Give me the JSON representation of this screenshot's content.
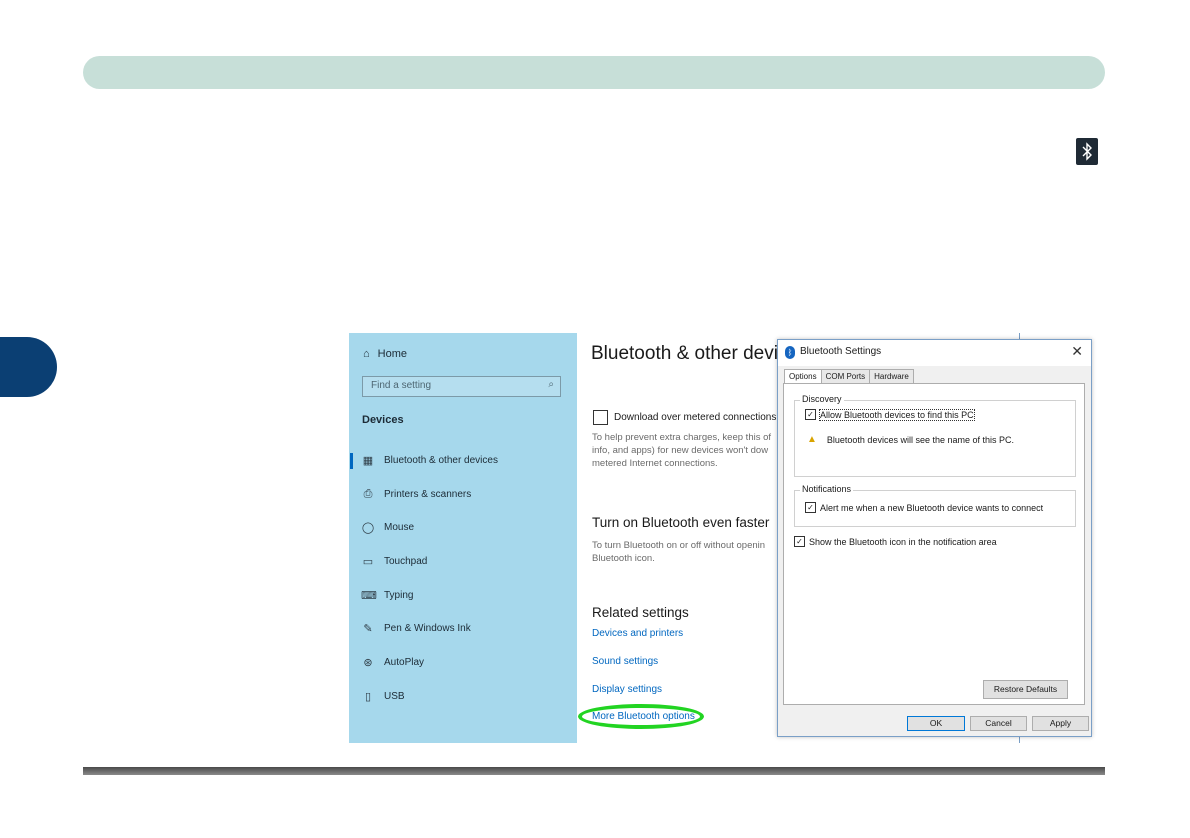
{
  "settings": {
    "sidebar": {
      "home": "Home",
      "search_placeholder": "Find a setting",
      "section_title": "Devices",
      "items": [
        {
          "label": "Bluetooth & other devices",
          "icon": "devices-icon"
        },
        {
          "label": "Printers & scanners",
          "icon": "printer-icon"
        },
        {
          "label": "Mouse",
          "icon": "mouse-icon"
        },
        {
          "label": "Touchpad",
          "icon": "touchpad-icon"
        },
        {
          "label": "Typing",
          "icon": "keyboard-icon"
        },
        {
          "label": "Pen & Windows Ink",
          "icon": "pen-icon"
        },
        {
          "label": "AutoPlay",
          "icon": "autoplay-icon"
        },
        {
          "label": "USB",
          "icon": "usb-icon"
        }
      ]
    },
    "main": {
      "title": "Bluetooth & other devi",
      "metered_label": "Download over metered connections",
      "metered_desc_1": "To help prevent extra charges, keep this of",
      "metered_desc_2": "info, and apps) for new devices won't dow",
      "metered_desc_3": "metered Internet connections.",
      "quick_title": "Turn on Bluetooth even faster",
      "quick_desc_1": "To turn Bluetooth on or off without openin",
      "quick_desc_2": "Bluetooth icon.",
      "related_title": "Related settings",
      "links": [
        "Devices and printers",
        "Sound settings",
        "Display settings",
        "More Bluetooth options"
      ]
    }
  },
  "dialog": {
    "title": "Bluetooth Settings",
    "tabs": [
      "Options",
      "COM Ports",
      "Hardware"
    ],
    "discovery_label": "Discovery",
    "allow_label": "Allow Bluetooth devices to find this PC",
    "warning": "Bluetooth devices will see the name of this PC.",
    "notifications_label": "Notifications",
    "alert_label": "Alert me when a new Bluetooth device wants to connect",
    "show_icon_label": "Show the Bluetooth icon in the notification area",
    "restore_btn": "Restore Defaults",
    "ok_btn": "OK",
    "cancel_btn": "Cancel",
    "apply_btn": "Apply"
  },
  "colors": {
    "header_bar": "#c7dfd8",
    "chapter_tab": "#0b3f73",
    "sidebar": "#a6d8ec",
    "link": "#0067c0",
    "highlight_oval": "#22d422"
  }
}
